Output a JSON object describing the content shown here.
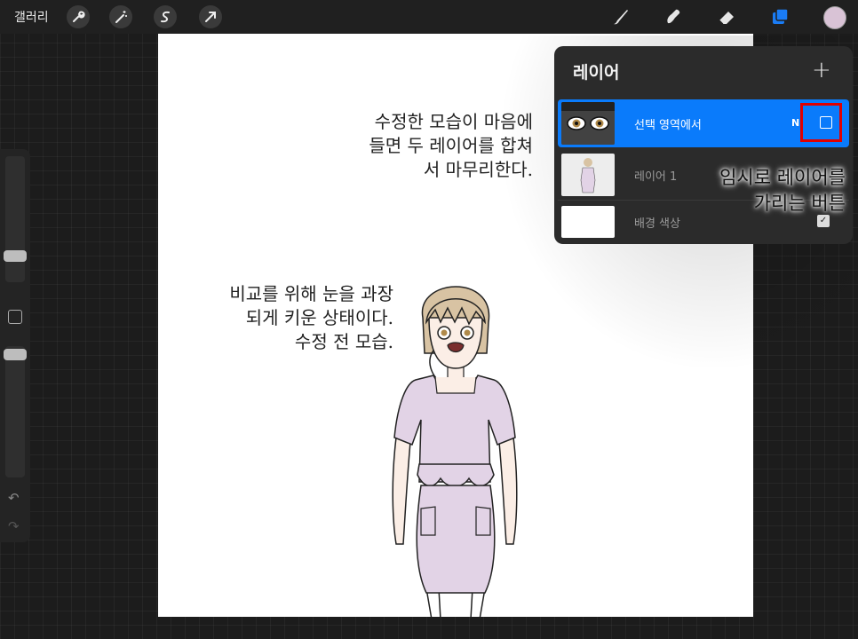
{
  "topbar": {
    "gallery_label": "갤러리",
    "tools_left": [
      "wrench-icon",
      "magic-wand-icon",
      "selection-icon",
      "transform-arrow-icon"
    ],
    "tools_right": [
      "brush-icon",
      "smudge-icon",
      "eraser-icon",
      "layers-icon"
    ],
    "active_color": "#d9c3d6",
    "accent": "#1a7cf5"
  },
  "canvas": {
    "note_top": "수정한 모습이 마음에\n들면 두 레이어를 합쳐\n서 마무리한다.",
    "note_mid": "비교를 위해 눈을 과장\n되게 키운 상태이다.\n수정 전 모습."
  },
  "layers_panel": {
    "title": "레이어",
    "add_button": "+",
    "layers": [
      {
        "name": "선택 영역에서",
        "blend": "N",
        "visible": false,
        "selected": true
      },
      {
        "name": "레이어 1",
        "blend": "N",
        "visible": true,
        "selected": false
      },
      {
        "name": "배경 색상",
        "blend": "",
        "visible": true,
        "selected": false
      }
    ]
  },
  "annotation": {
    "text": "임시로 레이어를\n가리는 버튼",
    "highlight_color": "#e00000"
  }
}
